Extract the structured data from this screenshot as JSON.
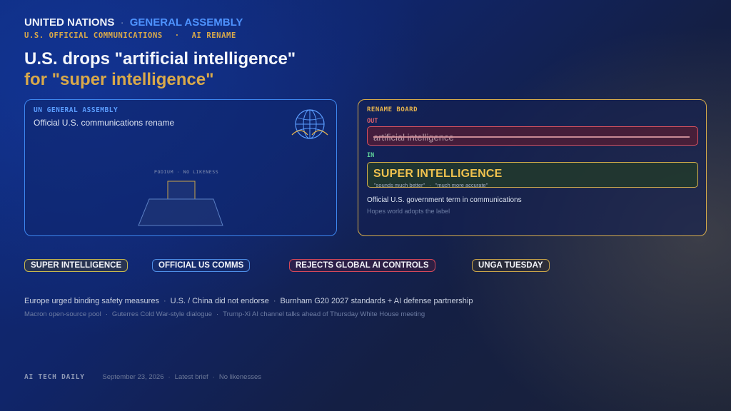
{
  "header": {
    "org": "UNITED NATIONS",
    "separator": "·",
    "body": "GENERAL ASSEMBLY",
    "tag_1": "U.S. OFFICIAL COMMUNICATIONS",
    "tag_sep": "·",
    "tag_2": "AI RENAME"
  },
  "headline": {
    "line1": "U.S. drops \"artificial intelligence\"",
    "line2": "for \"super intelligence\""
  },
  "left_panel": {
    "title": "UN GENERAL ASSEMBLY",
    "subtitle": "Official U.S. communications rename",
    "podium_label": "PODIUM  ·  NO LIKENESS",
    "icon": "globe-icon"
  },
  "rename_board": {
    "title": "RENAME BOARD",
    "out_label": "OUT",
    "out_term": "artificial intelligence",
    "in_label": "IN",
    "in_term": "SUPER INTELLIGENCE",
    "quote_1": "\"sounds much better\"",
    "quote_sep": "·",
    "quote_2": "\"much more accurate\"",
    "description": "Official U.S. government term in communications",
    "note": "Hopes world adopts the label"
  },
  "tags": [
    {
      "label": "SUPER INTELLIGENCE",
      "color": "#c7b84e"
    },
    {
      "label": "OFFICIAL US COMMS",
      "color": "#4e8fe8"
    },
    {
      "label": "REJECTS GLOBAL AI CONTROLS",
      "color": "#d4485a"
    },
    {
      "label": "UNGA TUESDAY",
      "color": "#c9a449"
    }
  ],
  "facts": {
    "line1": [
      "Europe urged binding safety measures",
      "U.S. / China did not endorse",
      "Burnham G20 2027 standards + AI defense partnership"
    ],
    "line2": [
      "Macron open-source pool",
      "Guterres Cold War-style dialogue",
      "Trump-Xi AI channel talks ahead of Thursday White House meeting"
    ],
    "separator": "·"
  },
  "footer": {
    "brand": "AI TECH DAILY",
    "date": "September 23, 2026",
    "item_2": "Latest brief",
    "item_3": "No likenesses",
    "separator": "·"
  },
  "colors": {
    "accent_blue": "#3d86ee",
    "accent_gold": "#d9a94a",
    "out_red": "#d9505e",
    "in_green": "#5fd39a"
  }
}
